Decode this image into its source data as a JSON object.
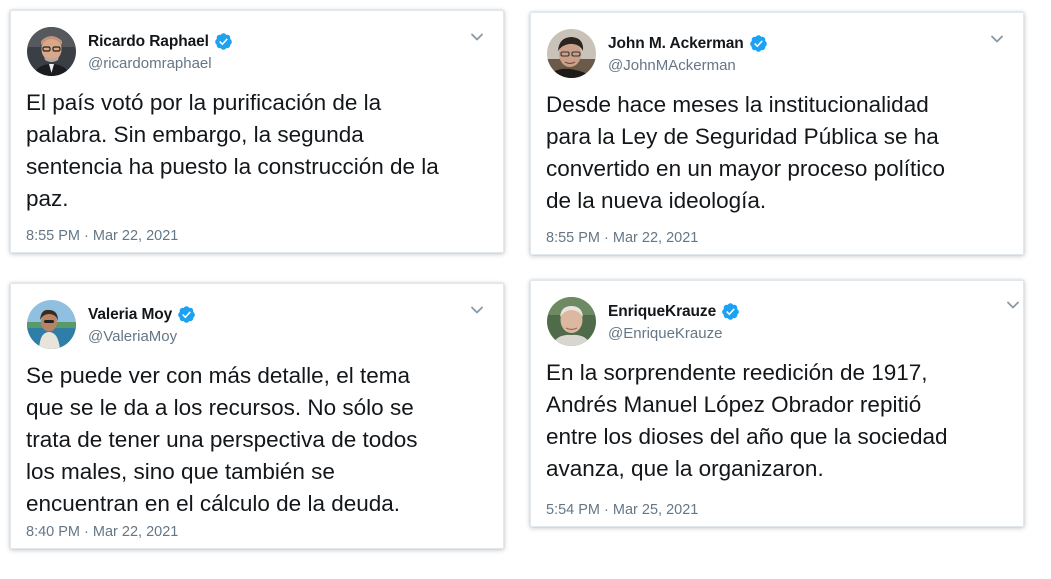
{
  "tweets": [
    {
      "name": "Ricardo Raphael",
      "handle": "@ricardomraphael",
      "text": "El país votó por la purificación de la\npalabra. Sin embargo, la segunda\nsentencia ha puesto la construcción de la\npaz.",
      "timestamp": "8:55 PM · Mar 22, 2021",
      "verified": true,
      "avatar_icon": "avatar-bald-man-glasses"
    },
    {
      "name": "John M. Ackerman",
      "handle": "@JohnMAckerman",
      "text": "Desde hace meses la institucionalidad\npara la Ley de Seguridad Pública  se ha\nconvertido en un mayor proceso político\nde la nueva ideología.",
      "timestamp": "8:55 PM · Mar 22, 2021",
      "verified": true,
      "avatar_icon": "avatar-man-dark-hair"
    },
    {
      "name": "Valeria Moy",
      "handle": "@ValeriaMoy",
      "text": "Se puede ver con más detalle, el tema\nque se le da a los recursos. No sólo se\ntrata de tener una perspectiva de todos\nlos males, sino que también se\nencuentran en el cálculo de la deuda.",
      "timestamp": "8:40 PM · Mar 22, 2021",
      "verified": true,
      "avatar_icon": "avatar-woman-outdoors"
    },
    {
      "name": "EnriqueKrauze",
      "handle": "@EnriqueKrauze",
      "text": "En la sorprendente reedición de 1917,\nAndrés Manuel López Obrador repitió\nentre los dioses del año que la sociedad\navanza, que la organizaron.",
      "timestamp": "5:54 PM · Mar 25, 2021",
      "verified": true,
      "avatar_icon": "avatar-older-man"
    }
  ],
  "colors": {
    "verified_badge": "#1da1f2",
    "name_text": "#14171a",
    "secondary_text": "#657786",
    "card_border": "#e1e8ed"
  }
}
